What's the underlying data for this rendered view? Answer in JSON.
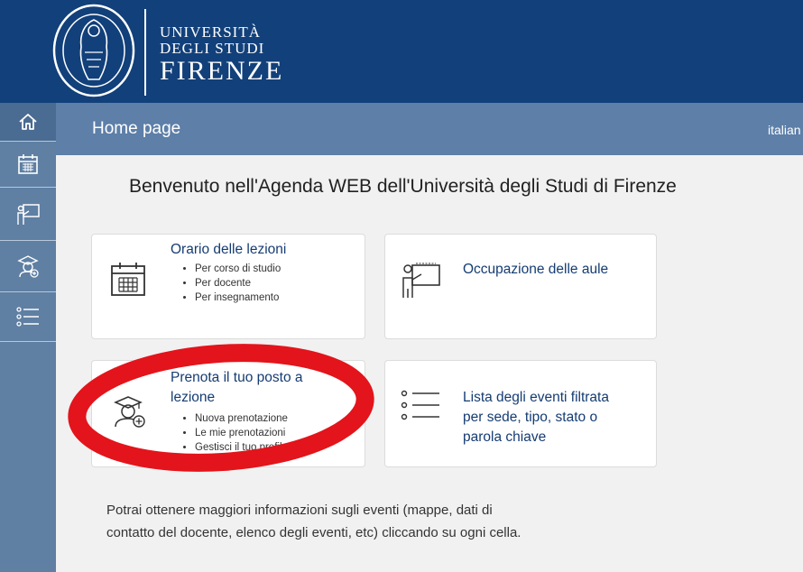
{
  "header": {
    "logo_lines": [
      "UNIVERSITÀ",
      "DEGLI STUDI",
      "FIRENZE"
    ],
    "seal_icon": "university-seal-icon"
  },
  "titlebar": {
    "title": "Home page",
    "language": "italian"
  },
  "sidebar": {
    "items": [
      {
        "icon": "home-icon",
        "active": true
      },
      {
        "icon": "calendar-icon"
      },
      {
        "icon": "teacher-board-icon"
      },
      {
        "icon": "student-add-icon"
      },
      {
        "icon": "list-icon"
      }
    ]
  },
  "main": {
    "welcome": "Benvenuto nell'Agenda WEB dell'Università degli Studi di Firenze",
    "cards": [
      {
        "title": "Orario delle lezioni",
        "items": [
          "Per corso di studio",
          "Per docente",
          "Per insegnamento"
        ],
        "icon": "calendar-icon"
      },
      {
        "title": "Occupazione delle aule",
        "icon": "teacher-board-icon"
      },
      {
        "title_lines": [
          "Prenota il tuo posto a",
          "lezione"
        ],
        "items": [
          "Nuova prenotazione",
          "Le mie prenotazioni",
          "Gestisci il tuo profilo"
        ],
        "icon": "student-add-icon"
      },
      {
        "title_lines": [
          "Lista degli eventi filtrata",
          "per sede, tipo, stato o",
          "parola chiave"
        ],
        "icon": "list-icon"
      }
    ],
    "footer_lines": [
      "Potrai ottenere maggiori informazioni sugli eventi (mappe, dati di",
      "contatto del docente, elenco degli eventi, etc) cliccando su ogni cella."
    ]
  },
  "colors": {
    "header": "#12407a",
    "sidebar": "#5f7fa3",
    "titlebar": "#5d7fa8",
    "link": "#153c72",
    "highlight": "#e3141b"
  }
}
